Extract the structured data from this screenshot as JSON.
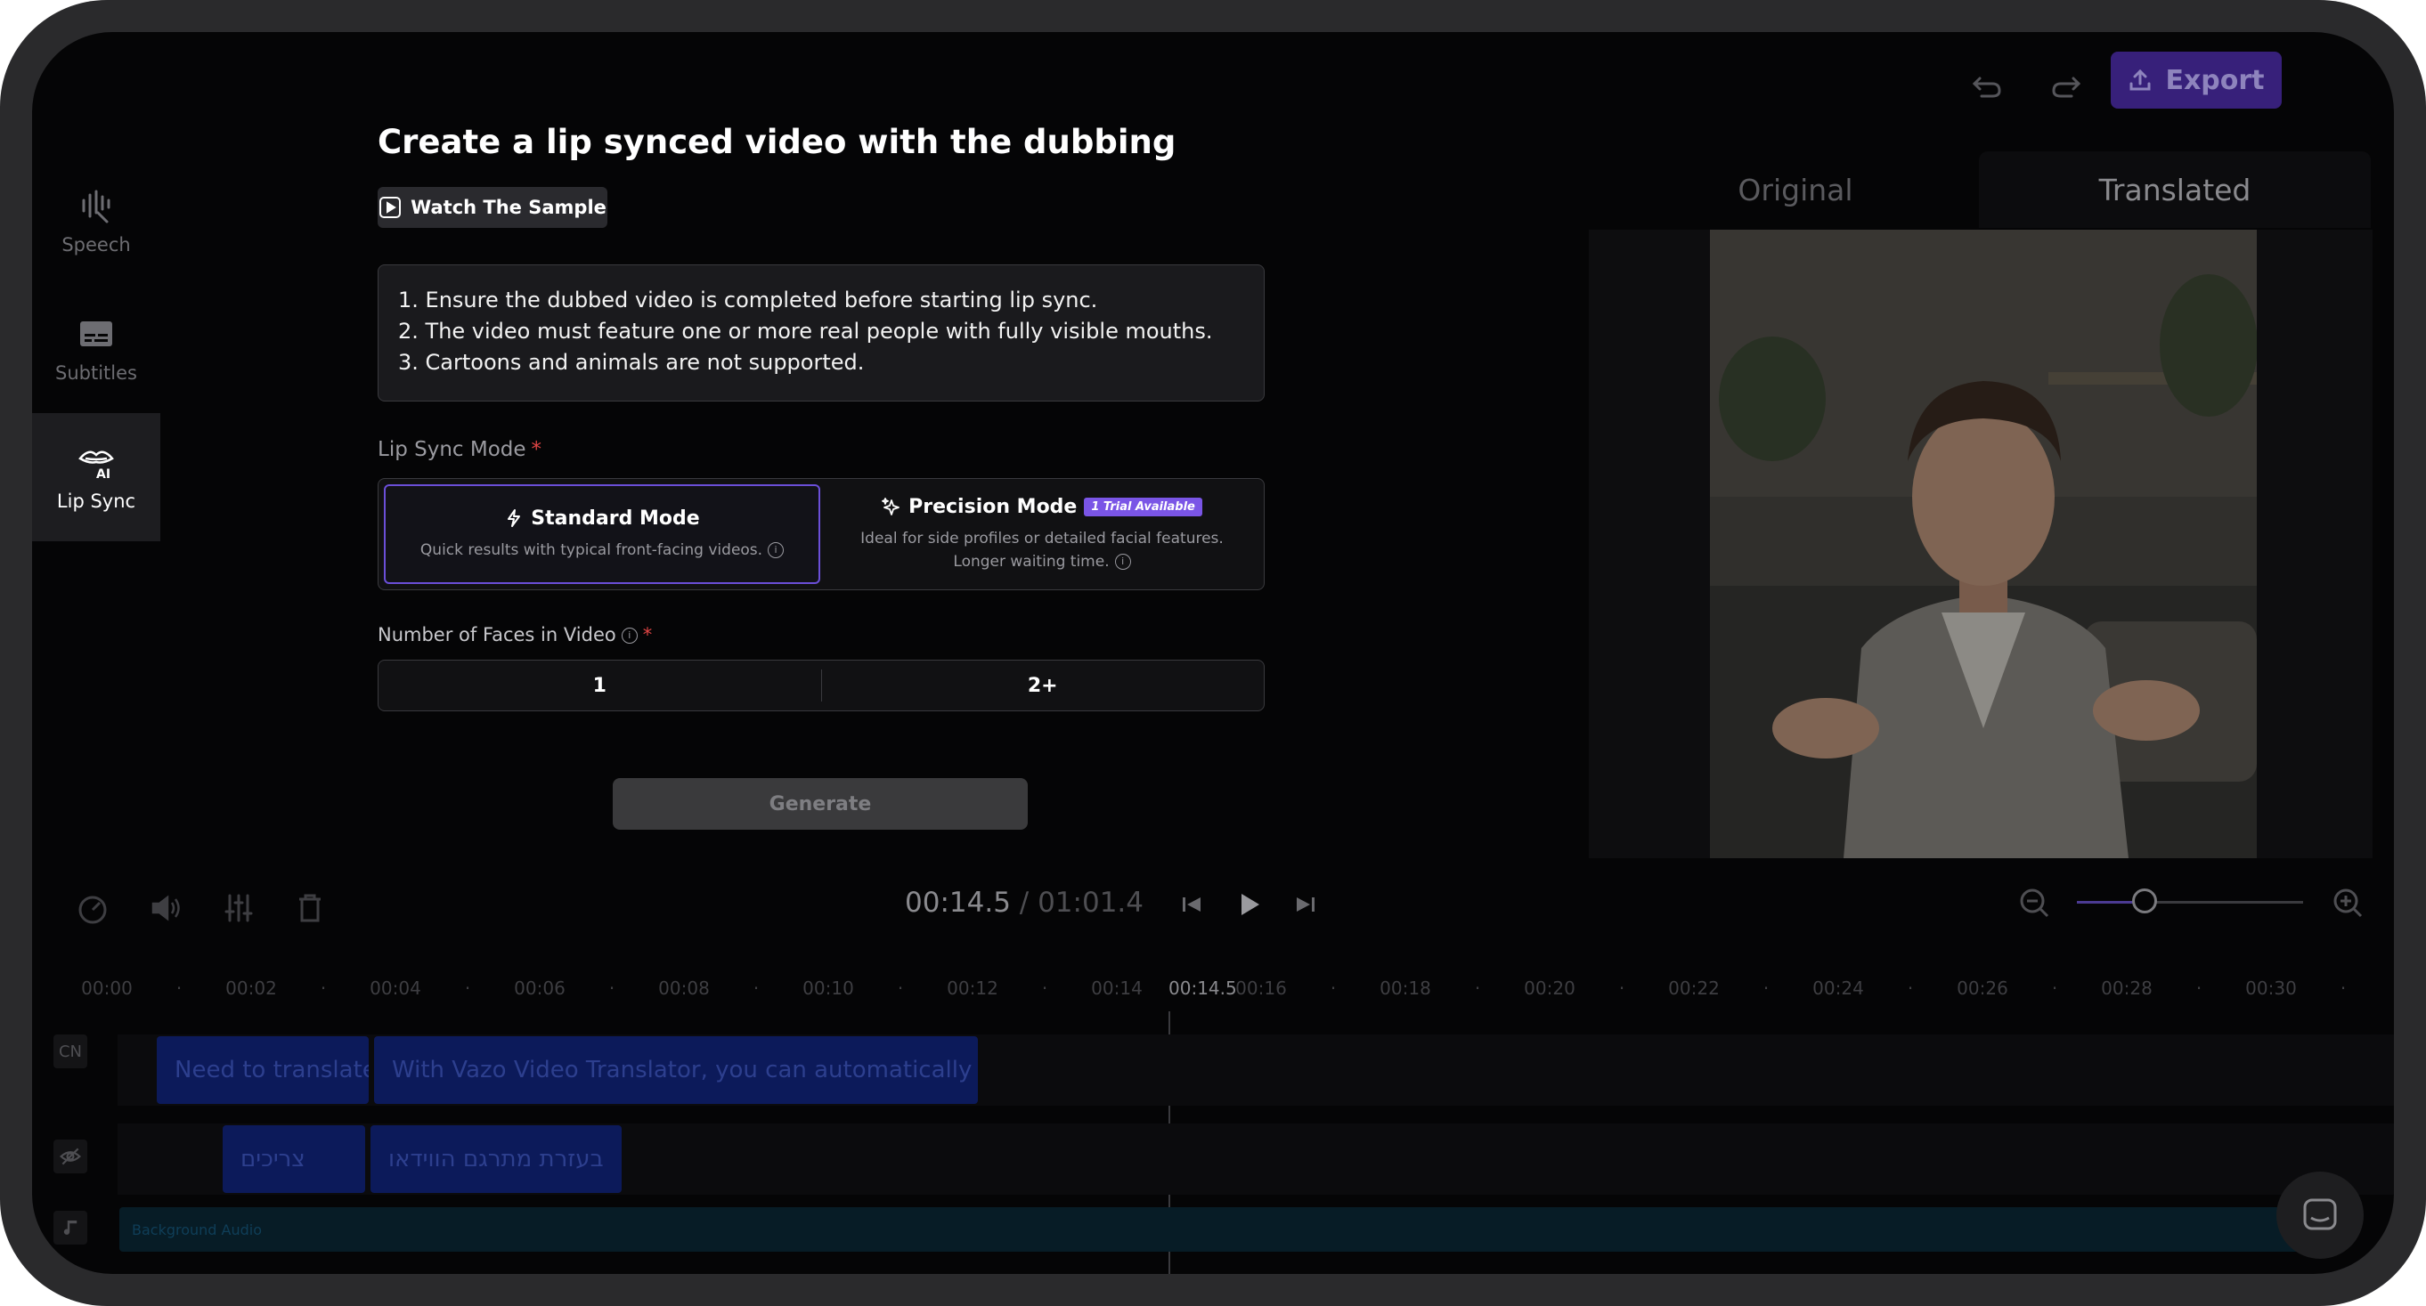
{
  "sidebar": {
    "items": [
      {
        "label": "Speech",
        "icon": "speech-waveform-icon"
      },
      {
        "label": "Subtitles",
        "icon": "subtitles-icon"
      },
      {
        "label": "Lip Sync",
        "icon": "lip-sync-ai-icon",
        "active": true
      }
    ]
  },
  "header": {
    "export_label": "Export"
  },
  "panel": {
    "title": "Create a lip synced video with the dubbing",
    "watch_sample_label": "Watch The Sample",
    "instructions": [
      "1. Ensure the dubbed video is completed before starting lip sync.",
      "2. The video must feature one or more real people with fully visible mouths.",
      "3. Cartoons and animals are not supported."
    ],
    "mode_label": "Lip Sync Mode",
    "required_mark": "*",
    "modes": {
      "standard": {
        "title": "Standard Mode",
        "desc": "Quick results with typical front-facing videos."
      },
      "precision": {
        "title": "Precision Mode",
        "badge": "1 Trial Available",
        "desc": "Ideal for side profiles or detailed facial features. Longer waiting time."
      }
    },
    "faces_label": "Number of Faces in Video",
    "faces_options": [
      "1",
      "2+"
    ],
    "generate_label": "Generate"
  },
  "preview": {
    "tabs": [
      "Original",
      "Translated"
    ],
    "active_tab": "Translated"
  },
  "player": {
    "current_time": "00:14.5",
    "separator": " / ",
    "total_time": "01:01.4",
    "zoom_level_fraction": 0.3
  },
  "timeline": {
    "ticks": [
      "00:00",
      "00:02",
      "00:04",
      "00:06",
      "00:08",
      "00:10",
      "00:12",
      "00:14",
      "00:16",
      "00:18",
      "00:20",
      "00:22",
      "00:24",
      "00:26",
      "00:28",
      "00:30"
    ],
    "playhead_label": "00:14.5",
    "tracks": {
      "cn_label": "CN",
      "source_clips": [
        "Need to translate",
        "With Vazo Video Translator, you can automatically"
      ],
      "target_clips": [
        "צריכים",
        "בעזרת מתרגם הווידאו"
      ],
      "audio_label": "Background Audio"
    }
  },
  "colors": {
    "accent": "#6b4fd8",
    "export_bg": "#37207a",
    "clip_bg": "#0c1a5a",
    "required": "#e04545"
  }
}
